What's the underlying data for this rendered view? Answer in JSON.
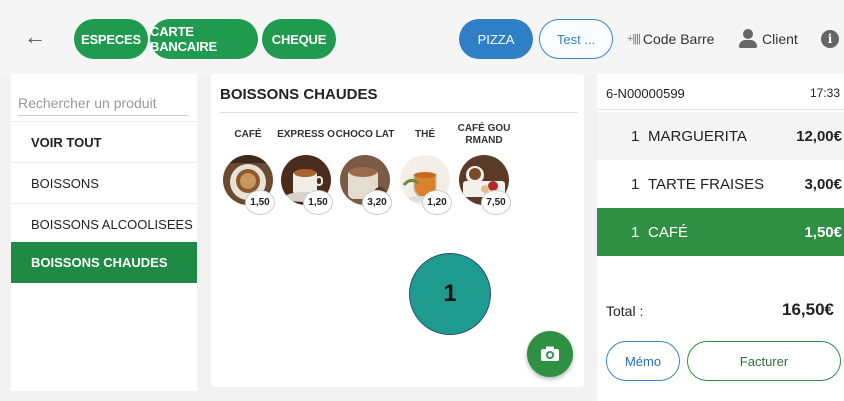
{
  "toolbar": {
    "back_icon": "arrow-left-icon",
    "payment_buttons": [
      "ESPECES",
      "CARTE BANCAIRE",
      "CHEQUE"
    ],
    "tables": [
      "PIZZA",
      "Test ..."
    ],
    "barcode_label": "Code Barre",
    "client_label": "Client",
    "accent_green": "#1f9a4f",
    "accent_blue": "#2f7fc6"
  },
  "sidebar": {
    "search_placeholder": "Rechercher un produit",
    "items": [
      {
        "label": "VOIR TOUT"
      },
      {
        "label": "BOISSONS"
      },
      {
        "label": "BOISSONS ALCOOLISEES"
      },
      {
        "label": "BOISSONS CHAUDES"
      }
    ]
  },
  "products": {
    "title": "BOISSONS CHAUDES",
    "items": [
      {
        "name": "CAFÉ",
        "price": "1,50"
      },
      {
        "name": "EXPRESS O",
        "price": "1,50"
      },
      {
        "name": "CHOCO LAT",
        "price": "3,20"
      },
      {
        "name": "THÉ",
        "price": "1,20"
      },
      {
        "name": "CAFÉ GOU RMAND",
        "price": "7,50"
      }
    ]
  },
  "annotation": {
    "label": "1"
  },
  "ticket": {
    "number": "6-N00000599",
    "time": "17:33",
    "lines": [
      {
        "qty": "1",
        "label": "MARGUERITA",
        "amount": "12,00€"
      },
      {
        "qty": "1",
        "label": "TARTE FRAISES",
        "amount": "3,00€"
      },
      {
        "qty": "1",
        "label": "CAFÉ",
        "amount": "1,50€"
      }
    ],
    "total_label": "Total :",
    "total_amount": "16,50€",
    "memo_label": "Mémo",
    "invoice_label": "Facturer"
  }
}
